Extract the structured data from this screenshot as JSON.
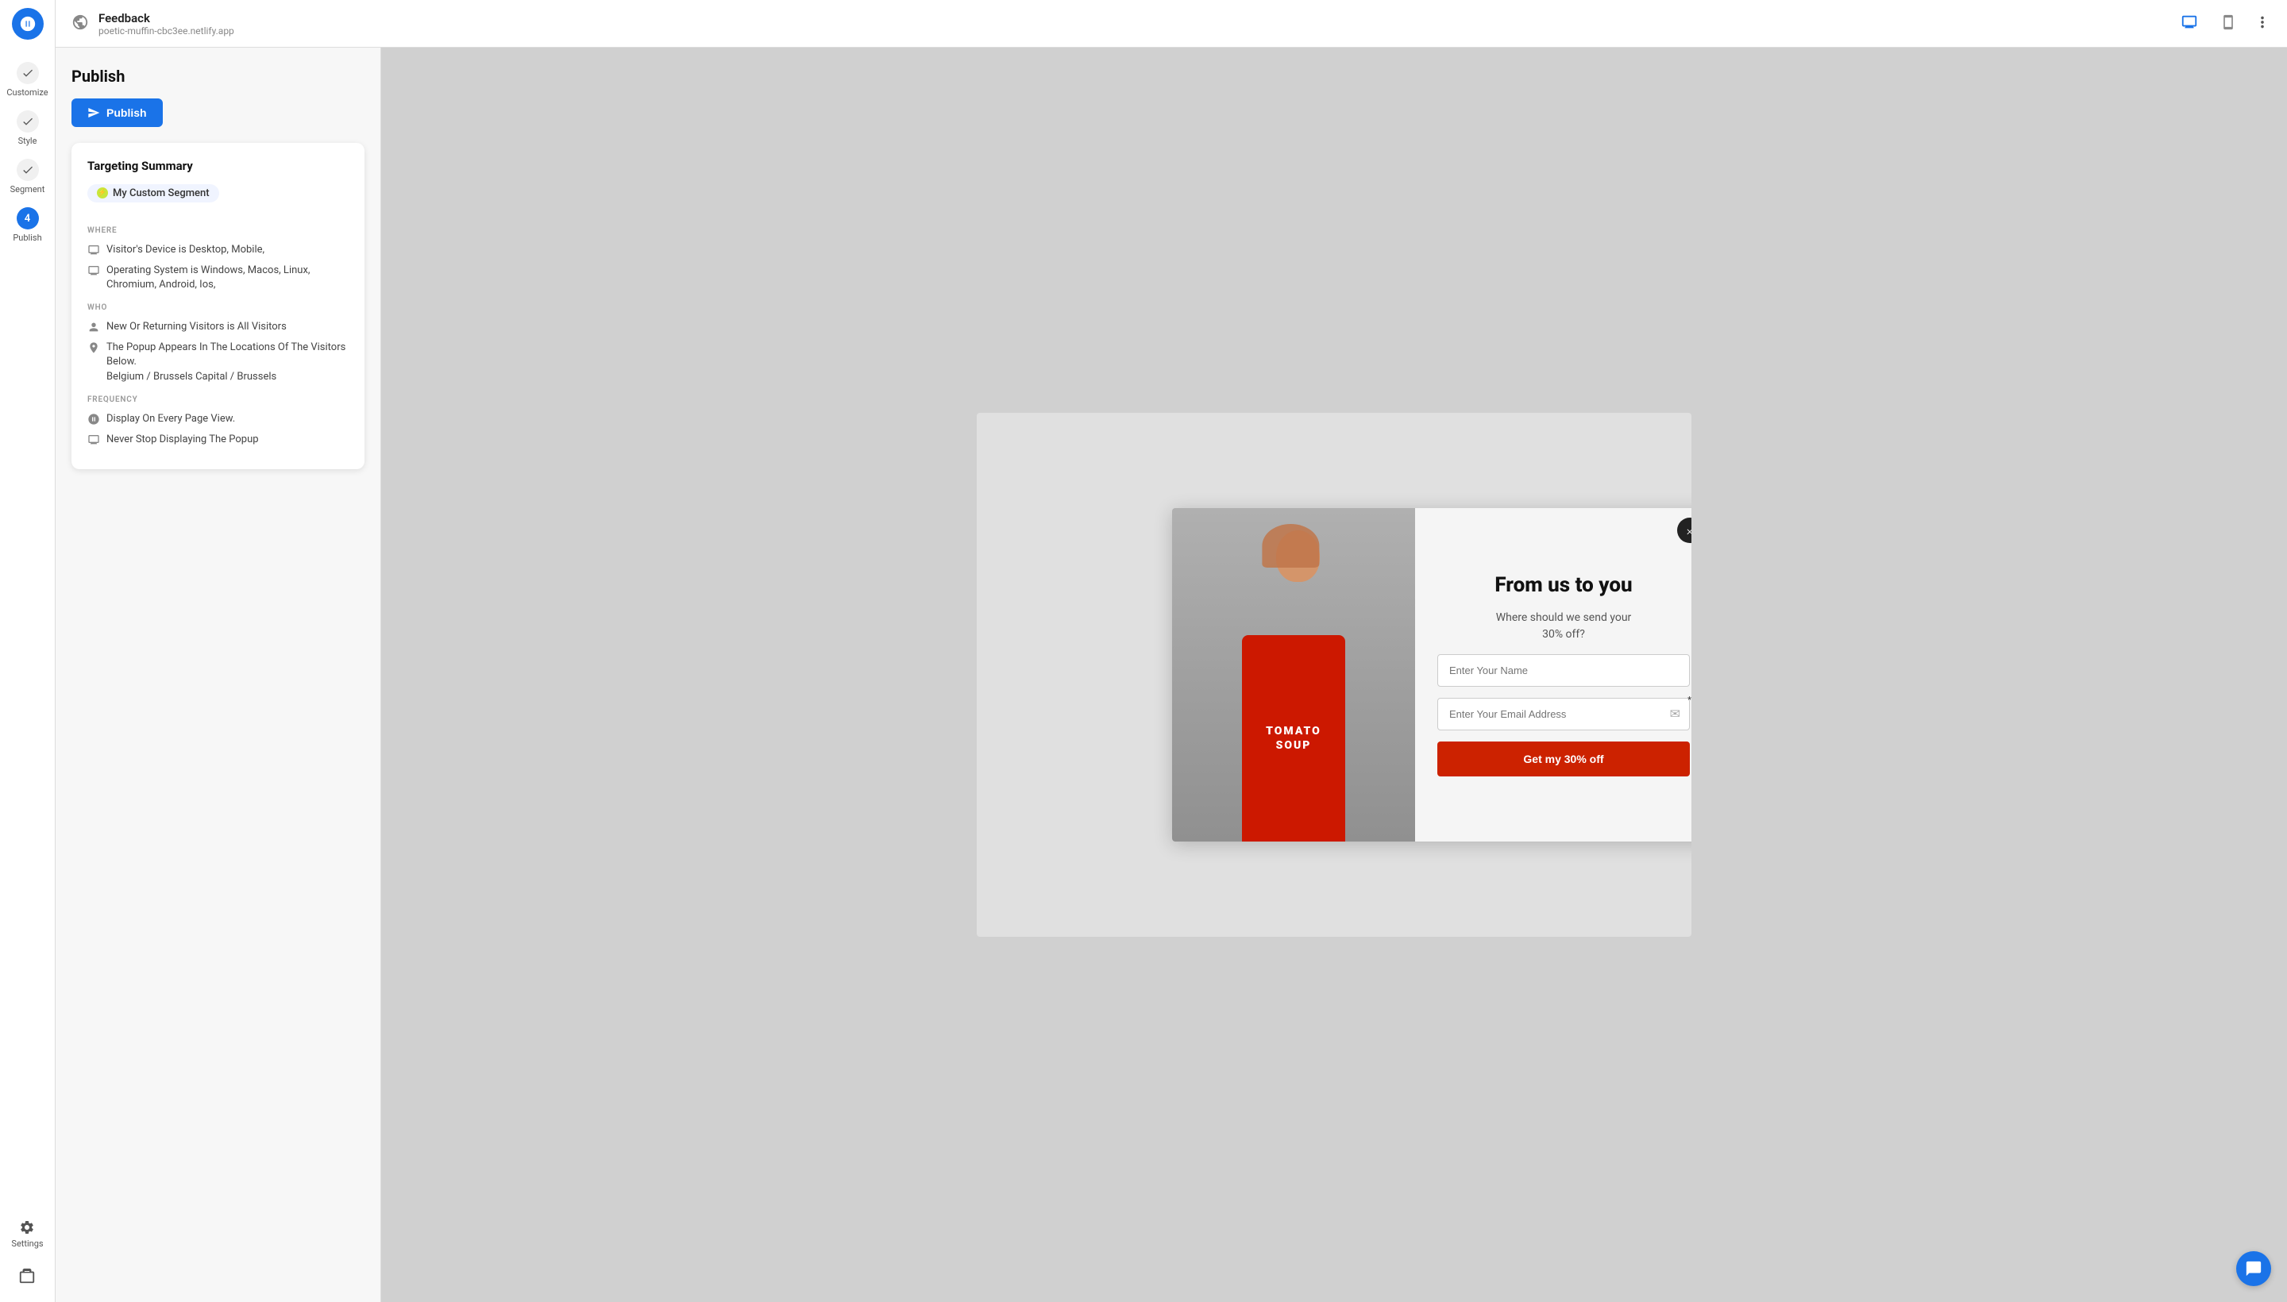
{
  "sidebar": {
    "logo_label": "App Logo",
    "items": [
      {
        "id": "customize",
        "label": "Customize",
        "state": "completed"
      },
      {
        "id": "style",
        "label": "Style",
        "state": "completed"
      },
      {
        "id": "segment",
        "label": "Segment",
        "state": "completed"
      },
      {
        "id": "publish",
        "label": "Publish",
        "state": "active",
        "step_number": "4"
      }
    ],
    "settings_label": "Settings"
  },
  "topbar": {
    "title": "Feedback",
    "subtitle": "poetic-muffin-cbc3ee.netlify.app",
    "device_desktop_label": "Desktop view",
    "device_mobile_label": "Mobile view",
    "more_options_label": "More options"
  },
  "panel": {
    "title": "Publish",
    "publish_button_label": "Publish",
    "targeting_card": {
      "title": "Targeting Summary",
      "segment_name": "My Custom Segment",
      "where_label": "WHERE",
      "where_items": [
        "Visitor's Device is Desktop, Mobile,",
        "Operating System is Windows, Macos, Linux, Chromium, Android, Ios,"
      ],
      "who_label": "WHO",
      "who_items": [
        "New Or Returning Visitors is All Visitors",
        "The Popup Appears In The Locations Of The Visitors Below.\nBelgium / Brussels Capital / Brussels"
      ],
      "frequency_label": "FREQUENCY",
      "frequency_items": [
        "Display On Every Page View.",
        "Never Stop Displaying The Popup"
      ]
    }
  },
  "popup": {
    "close_label": "×",
    "heading": "From us to you",
    "subtext": "Where should we send your\n30% off?",
    "name_placeholder": "Enter Your Name",
    "email_placeholder": "Enter Your Email Address",
    "cta_label": "Get my 30% off",
    "image_text_line1": "TOMATO",
    "image_text_line2": "SOUP"
  }
}
